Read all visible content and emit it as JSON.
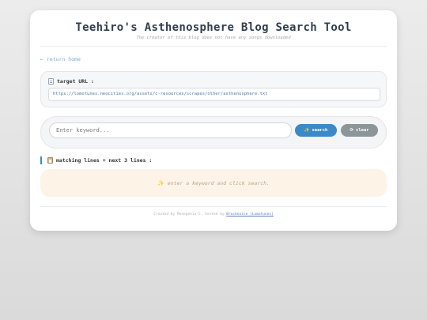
{
  "header": {
    "title": "Teehiro's Asthenosphere Blog Search Tool",
    "subtitle": "The creator of this blog does not have any songs downloaded"
  },
  "nav": {
    "back_link": "← return home"
  },
  "target": {
    "label": "target URL :",
    "icon": "document-icon",
    "url": "https://lomotunes.neocities.org/assets/c-resources/scrapes/other/asthenosphere.txt"
  },
  "search": {
    "placeholder": "Enter keyword...",
    "value": "",
    "search_label": "search",
    "search_icon": "✨",
    "clear_label": "clear",
    "clear_icon": "⟳"
  },
  "results": {
    "header": "matching lines + next 3 lines :",
    "icon": "clipboard-icon",
    "empty_message": "enter a keyword and click search.",
    "empty_icon": "✨"
  },
  "footer": {
    "prefix": "Created by Monogenio-C, hosted by ",
    "link_text": "Brucknoise (Lomotunes)"
  },
  "colors": {
    "accent": "#3a8ac9",
    "clear_button": "#8c9699",
    "result_bg": "#fdf3e6"
  }
}
